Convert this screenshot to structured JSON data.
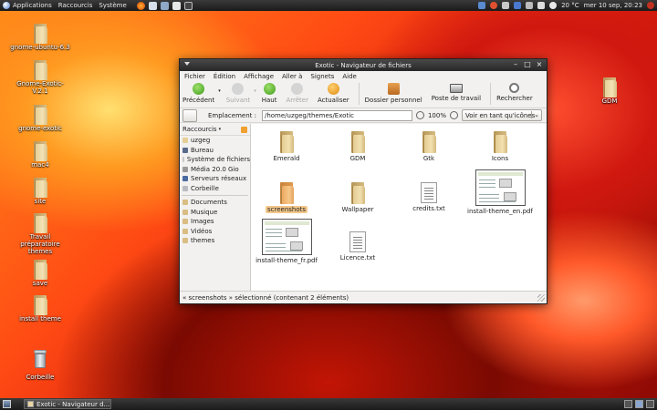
{
  "top_panel": {
    "menus": [
      "Applications",
      "Raccourcis",
      "Système"
    ],
    "weather": "20 °C",
    "clock": "mer 10 sep, 20:23"
  },
  "desktop_icons": [
    {
      "label": "gnome-ubuntu-6.3",
      "type": "folder"
    },
    {
      "label": "Gnome-Exotic-V.2.1",
      "type": "folder"
    },
    {
      "label": "gnome-exotic",
      "type": "folder"
    },
    {
      "label": "mac4",
      "type": "folder"
    },
    {
      "label": "site",
      "type": "folder"
    },
    {
      "label": "Travail préparatoire themes",
      "type": "folder"
    },
    {
      "label": "save",
      "type": "folder"
    },
    {
      "label": "install theme",
      "type": "folder"
    },
    {
      "label": "Corbeille",
      "type": "trash"
    },
    {
      "label": "GDM",
      "type": "folder"
    }
  ],
  "window": {
    "title": "Exotic - Navigateur de fichiers",
    "menubar": [
      "Fichier",
      "Édition",
      "Affichage",
      "Aller à",
      "Signets",
      "Aide"
    ],
    "toolbar": {
      "back": "Précédent",
      "forward": "Suivant",
      "up": "Haut",
      "stop": "Arrêter",
      "reload": "Actualiser",
      "home": "Dossier personnel",
      "computer": "Poste de travail",
      "search": "Rechercher"
    },
    "location": {
      "label": "Emplacement :",
      "path": "/home/uzgeg/themes/Exotic",
      "zoom": "100%",
      "view_mode": "Voir en tant qu'icônes"
    },
    "sidebar": {
      "title": "Raccourcis",
      "places": [
        {
          "label": "uzgeg",
          "color": "#e6cf97"
        },
        {
          "label": "Bureau",
          "color": "#5a6a8a"
        },
        {
          "label": "Système de fichiers",
          "color": "#c8c8c8"
        },
        {
          "label": "Média 20.0 Gio",
          "color": "#9a9a9a"
        },
        {
          "label": "Serveurs réseaux",
          "color": "#4a6aa0"
        },
        {
          "label": "Corbeille",
          "color": "#b8bcc0"
        }
      ],
      "bookmarks": [
        {
          "label": "Documents",
          "color": "#d9bd83"
        },
        {
          "label": "Musique",
          "color": "#d9bd83"
        },
        {
          "label": "Images",
          "color": "#d9bd83"
        },
        {
          "label": "Vidéos",
          "color": "#d9bd83"
        },
        {
          "label": "themes",
          "color": "#d9bd83"
        }
      ]
    },
    "files": [
      {
        "name": "Emerald",
        "type": "folder",
        "selected": false
      },
      {
        "name": "GDM",
        "type": "folder",
        "selected": false
      },
      {
        "name": "Gtk",
        "type": "folder",
        "selected": false
      },
      {
        "name": "Icons",
        "type": "folder",
        "selected": false
      },
      {
        "name": "screenshots",
        "type": "folder",
        "selected": true
      },
      {
        "name": "Wallpaper",
        "type": "folder",
        "selected": false
      },
      {
        "name": "credits.txt",
        "type": "text",
        "selected": false
      },
      {
        "name": "install-theme_en.pdf",
        "type": "pdf",
        "selected": false
      },
      {
        "name": "install-theme_fr.pdf",
        "type": "pdf",
        "selected": false
      },
      {
        "name": "Licence.txt",
        "type": "text",
        "selected": false
      }
    ],
    "status": "« screenshots » sélectionné (contenant 2 éléments)"
  },
  "bottom_panel": {
    "task": "Exotic - Navigateur d..."
  },
  "colors": {
    "selection": "#f3c78a",
    "panel": "#262626",
    "accent_orange": "#f0a030"
  }
}
